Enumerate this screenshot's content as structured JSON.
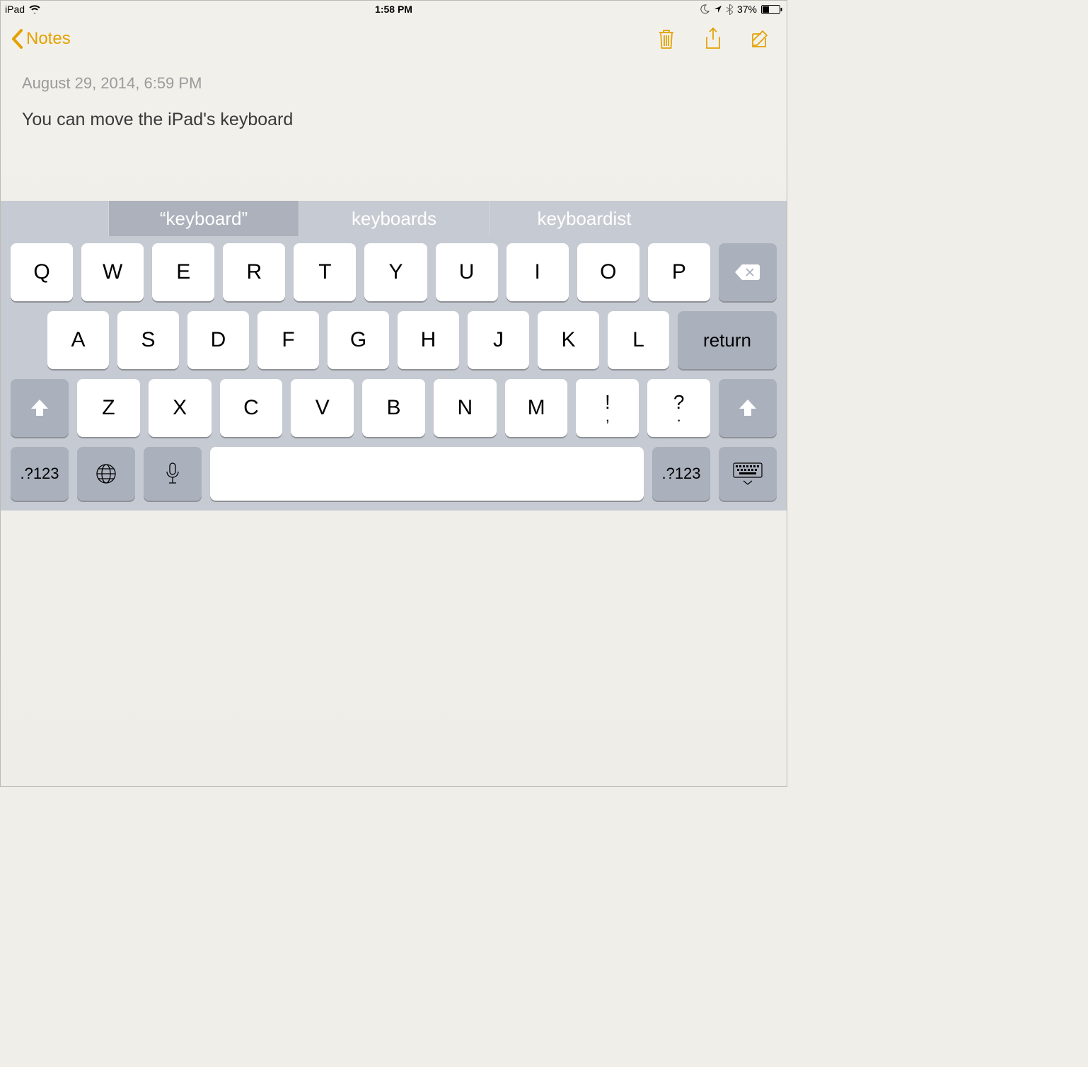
{
  "statusbar": {
    "device": "iPad",
    "time": "1:58 PM",
    "battery_pct": "37%"
  },
  "nav": {
    "back_label": "Notes"
  },
  "note": {
    "timestamp": "August 29, 2014, 6:59 PM",
    "body": "You can move the iPad's keyboard"
  },
  "suggestions": {
    "items": [
      "“keyboard”",
      "keyboards",
      "keyboardist"
    ]
  },
  "keyboard": {
    "row1": [
      "Q",
      "W",
      "E",
      "R",
      "T",
      "Y",
      "U",
      "I",
      "O",
      "P"
    ],
    "row2": [
      "A",
      "S",
      "D",
      "F",
      "G",
      "H",
      "J",
      "K",
      "L"
    ],
    "return_label": "return",
    "row3": [
      "Z",
      "X",
      "C",
      "V",
      "B",
      "N",
      "M"
    ],
    "punct_excl_top": "!",
    "punct_excl_bot": ",",
    "punct_q_top": "?",
    "punct_q_bot": ".",
    "numkey_label": ".?123"
  }
}
